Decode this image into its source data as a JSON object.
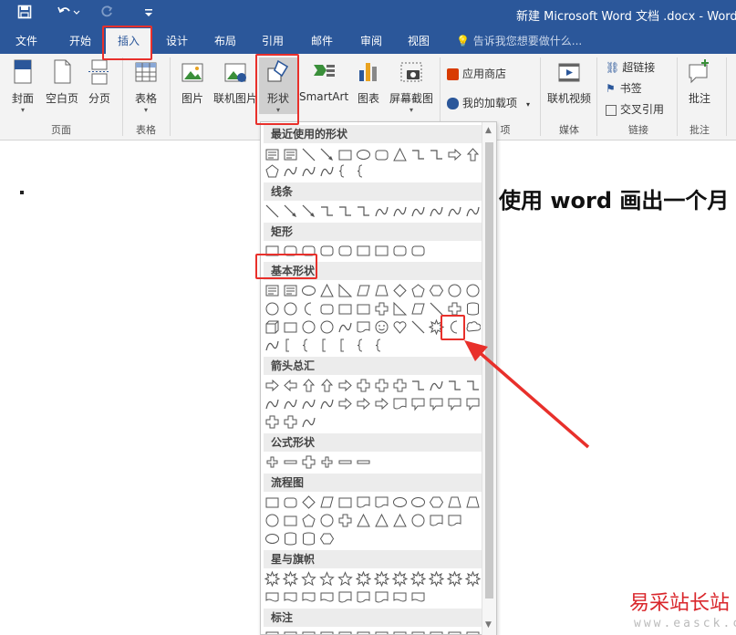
{
  "window": {
    "title": "新建 Microsoft Word 文档 .docx - Word"
  },
  "tabs": [
    "文件",
    "开始",
    "插入",
    "设计",
    "布局",
    "引用",
    "邮件",
    "审阅",
    "视图"
  ],
  "active_tab": "插入",
  "tell_me": {
    "placeholder": "告诉我您想要做什么..."
  },
  "ribbon": {
    "pages": {
      "cover": "封面",
      "blank": "空白页",
      "break": "分页",
      "label": "页面"
    },
    "tables": {
      "table": "表格",
      "label": "表格"
    },
    "illustrations": {
      "picture": "图片",
      "online_picture": "联机图片",
      "shapes": "形状",
      "smartart": "SmartArt",
      "chart": "图表",
      "screenshot": "屏幕截图"
    },
    "addins": {
      "store": "应用商店",
      "my_addins": "我的加载项",
      "label_tail": "项"
    },
    "media": {
      "online_video": "联机视频",
      "label": "媒体"
    },
    "links": {
      "hyperlink": "超链接",
      "bookmark": "书签",
      "cross_ref": "交叉引用",
      "label": "链接"
    },
    "comments": {
      "comment": "批注",
      "label": "批注"
    }
  },
  "shapes_menu": {
    "sections": [
      "最近使用的形状",
      "线条",
      "矩形",
      "基本形状",
      "箭头总汇",
      "公式形状",
      "流程图",
      "星与旗帜",
      "标注"
    ]
  },
  "document": {
    "heading_text": "使用 word 画出一个月"
  },
  "watermark": {
    "text": "易采站长站",
    "url": "www.easck.com"
  },
  "colors": {
    "accent": "#2b579a",
    "highlight": "#e8302b"
  }
}
